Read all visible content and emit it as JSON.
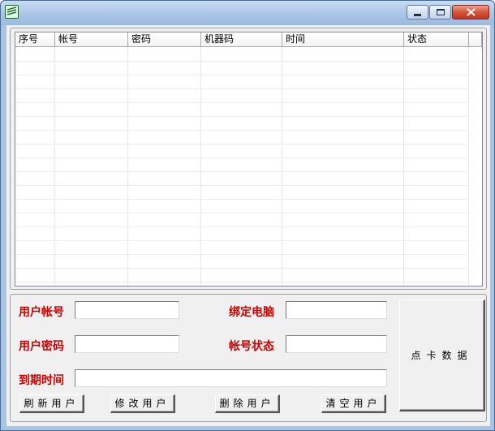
{
  "window": {
    "title": "",
    "controls": [
      "minimize-icon",
      "maximize-icon",
      "close-icon"
    ],
    "colors": {
      "frame": "#a9c4e3",
      "close": "#c0341b"
    }
  },
  "list": {
    "columns": [
      "序号",
      "帐号",
      "密码",
      "机器码",
      "时间",
      "状态"
    ],
    "rows": []
  },
  "form": {
    "account_label": "用户帐号",
    "account_value": "",
    "bind_pc_label": "绑定电脑",
    "bind_pc_value": "",
    "password_label": "用户密码",
    "password_value": "",
    "status_label": "帐号状态",
    "status_value": "",
    "expire_label": "到期时间",
    "expire_value": "",
    "label_color": "#cc0000"
  },
  "buttons": {
    "refresh": "刷新用户",
    "modify": "修改用户",
    "delete": "删除用户",
    "clear": "清空用户",
    "point_card": "点卡数据"
  }
}
